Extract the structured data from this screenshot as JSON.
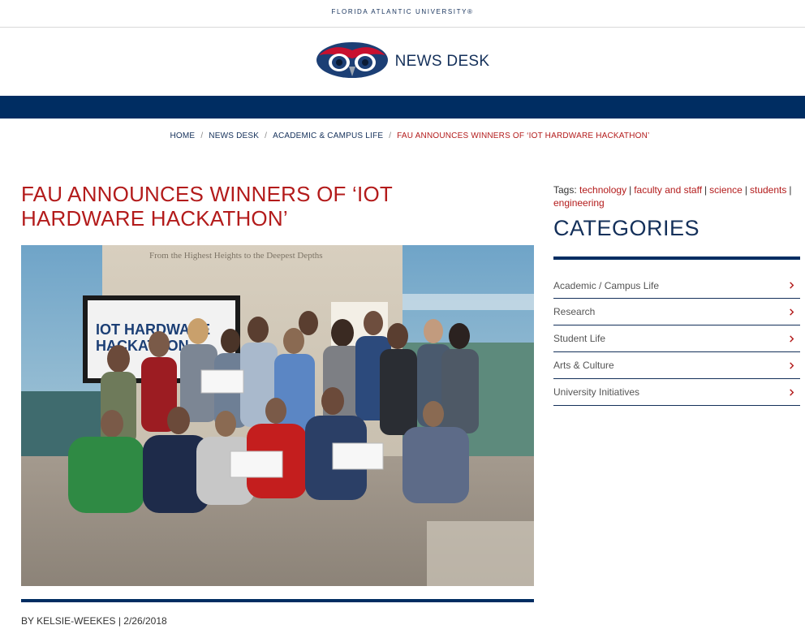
{
  "top": {
    "university": "FLORIDA ATLANTIC UNIVERSITY®"
  },
  "header": {
    "title": "NEWS DESK"
  },
  "breadcrumb": {
    "items": [
      "HOME",
      "NEWS DESK",
      "ACADEMIC & CAMPUS LIFE"
    ],
    "separator": "/",
    "current": "FAU ANNOUNCES WINNERS OF ‘IOT HARDWARE HACKATHON’"
  },
  "article": {
    "title_line1": "FAU ANNOUNCES WINNERS OF ‘IOT",
    "title_line2": "HARDWARE HACKATHON’",
    "byline": "BY KELSIE-WEEKES | 2/26/2018",
    "photo": {
      "wall_text": "From the Highest Heights to the Deepest Depths",
      "screen_line1": "IOT HARDWARE",
      "screen_line2": "HACKATHON"
    }
  },
  "sidebar": {
    "tags_label": "Tags:",
    "tags": [
      "technology",
      "faculty and staff",
      "science",
      "students",
      "engineering"
    ],
    "categories_heading": "CATEGORIES",
    "categories": [
      "Academic / Campus Life",
      "Research",
      "Student Life",
      "Arts & Culture",
      "University Initiatives"
    ]
  },
  "colors": {
    "navy": "#002d62",
    "red": "#b31b1b"
  },
  "icons": {
    "logo": "owl-logo-icon",
    "chevron": "chevron-right-icon"
  }
}
